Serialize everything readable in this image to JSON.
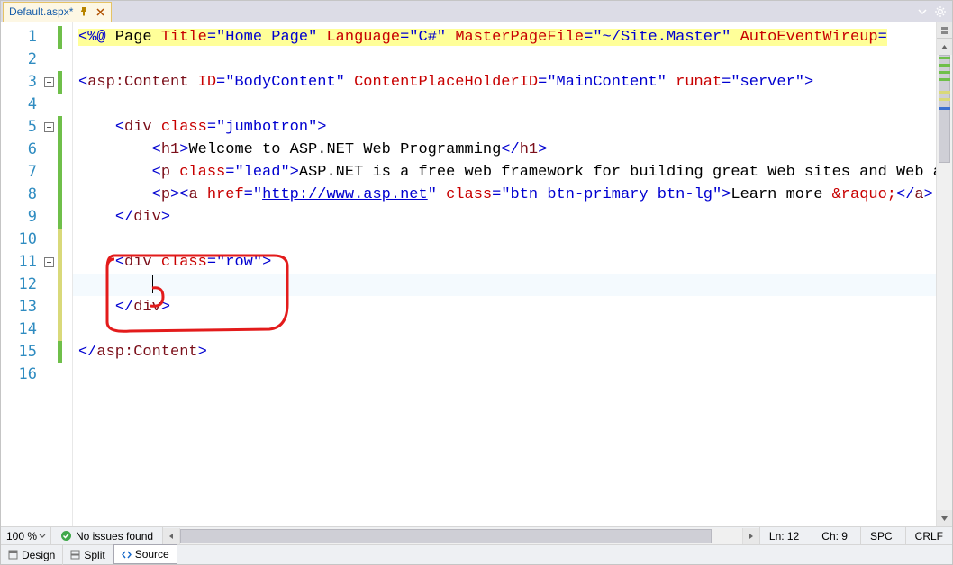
{
  "tab": {
    "label": "Default.aspx*"
  },
  "lines": {
    "count": 16,
    "l1": {
      "directive": "<%@",
      "txt1": " Page ",
      "a1": "Title",
      "v1": "\"Home Page\"",
      "a2": "Language",
      "v2": "\"C#\"",
      "a3": "MasterPageFile",
      "v3": "\"~/Site.Master\"",
      "a4": "AutoEventWireup",
      "eq": "="
    },
    "l3": {
      "lt": "<",
      "tag": "asp:Content",
      "sp": " ",
      "a1": "ID",
      "v1": "\"BodyContent\"",
      "a2": "ContentPlaceHolderID",
      "v2": "\"MainContent\"",
      "a3": "runat",
      "v3": "\"server\"",
      "gt": ">"
    },
    "l5": {
      "indent": "    ",
      "lt": "<",
      "tag": "div",
      "sp": " ",
      "a1": "class",
      "v1": "\"jumbotron\"",
      "gt": ">"
    },
    "l6": {
      "indent": "        ",
      "lt1": "<",
      "tag1": "h1",
      "gt1": ">",
      "text": "Welcome to ASP.NET Web Programming",
      "lt2": "</",
      "tag2": "h1",
      "gt2": ">"
    },
    "l7": {
      "indent": "        ",
      "lt": "<",
      "tag": "p",
      "sp": " ",
      "a1": "class",
      "v1": "\"lead\"",
      "gt": ">",
      "text": "ASP.NET is a free web framework for building great Web sites and Web ap"
    },
    "l8": {
      "indent": "        ",
      "lt1": "<",
      "tag1": "p",
      "gt1": "><",
      "taga": "a",
      "sp": " ",
      "a1": "href",
      "v1": "\"",
      "url": "http://www.asp.net",
      "v1b": "\"",
      "a2": "class",
      "v2": "\"btn btn-primary btn-lg\"",
      "gt2": ">",
      "text": "Learn more ",
      "ent": "&raquo;",
      "close_a": "</",
      "taga2": "a",
      "gt3": ">"
    },
    "l9": {
      "indent": "    ",
      "lt": "</",
      "tag": "div",
      "gt": ">"
    },
    "l11": {
      "indent": "    ",
      "lt": "<",
      "tag": "div",
      "sp": " ",
      "a1": "class",
      "v1": "\"row\"",
      "gt": ">"
    },
    "l12": {
      "indent": "        "
    },
    "l13": {
      "indent": "    ",
      "lt": "</",
      "tag": "div",
      "gt": ">"
    },
    "l15": {
      "lt": "</",
      "tag": "asp:Content",
      "gt": ">"
    }
  },
  "footer": {
    "zoom": "100 %",
    "issues": "No issues found",
    "line_lbl": "Ln: 12",
    "col_lbl": "Ch: 9",
    "ins": "SPC",
    "crlf": "CRLF"
  },
  "views": {
    "design": "Design",
    "split": "Split",
    "source": "Source"
  }
}
